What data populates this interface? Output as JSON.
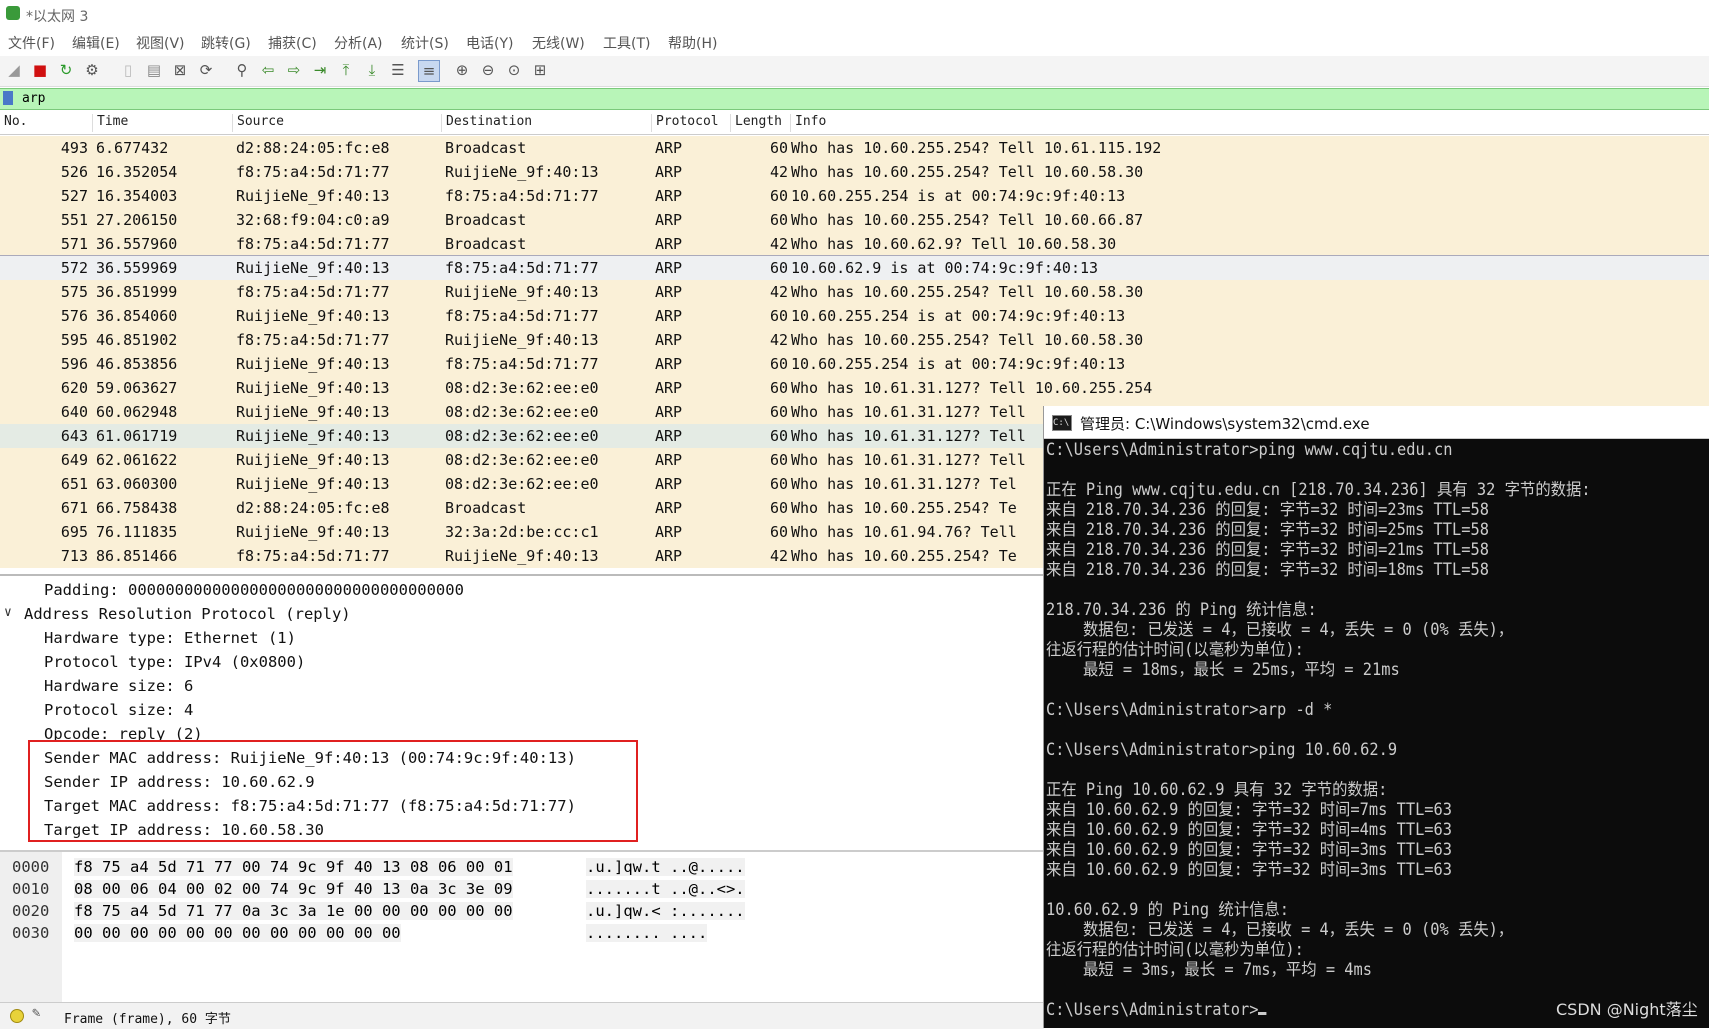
{
  "window": {
    "title": "*以太网 3"
  },
  "menu": [
    "文件(F)",
    "编辑(E)",
    "视图(V)",
    "跳转(G)",
    "捕获(C)",
    "分析(A)",
    "统计(S)",
    "电话(Y)",
    "无线(W)",
    "工具(T)",
    "帮助(H)"
  ],
  "toolbar_icons": [
    "shark-fin-start-icon",
    "stop-capture-icon",
    "restart-capture-icon",
    "capture-options-icon",
    "open-file-icon",
    "save-file-icon",
    "close-file-icon",
    "reload-icon",
    "find-packet-icon",
    "go-back-icon",
    "go-forward-icon",
    "go-to-packet-icon",
    "go-first-icon",
    "go-last-icon",
    "auto-scroll-icon",
    "colorize-icon",
    "zoom-in-icon",
    "zoom-out-icon",
    "zoom-normal-icon",
    "resize-columns-icon"
  ],
  "filter": {
    "value": "arp"
  },
  "packet_list": {
    "headers": [
      "No.",
      "Time",
      "Source",
      "Destination",
      "Protocol",
      "Length",
      "Info"
    ],
    "rows": [
      {
        "no": "493",
        "time": "6.677432",
        "src": "d2:88:24:05:fc:e8",
        "dst": "Broadcast",
        "proto": "ARP",
        "len": "60",
        "info": "Who has 10.60.255.254? Tell 10.61.115.192"
      },
      {
        "no": "526",
        "time": "16.352054",
        "src": "f8:75:a4:5d:71:77",
        "dst": "RuijieNe_9f:40:13",
        "proto": "ARP",
        "len": "42",
        "info": "Who has 10.60.255.254? Tell 10.60.58.30"
      },
      {
        "no": "527",
        "time": "16.354003",
        "src": "RuijieNe_9f:40:13",
        "dst": "f8:75:a4:5d:71:77",
        "proto": "ARP",
        "len": "60",
        "info": "10.60.255.254 is at 00:74:9c:9f:40:13"
      },
      {
        "no": "551",
        "time": "27.206150",
        "src": "32:68:f9:04:c0:a9",
        "dst": "Broadcast",
        "proto": "ARP",
        "len": "60",
        "info": "Who has 10.60.255.254? Tell 10.60.66.87"
      },
      {
        "no": "571",
        "time": "36.557960",
        "src": "f8:75:a4:5d:71:77",
        "dst": "Broadcast",
        "proto": "ARP",
        "len": "42",
        "info": "Who has 10.60.62.9? Tell 10.60.58.30"
      },
      {
        "no": "572",
        "time": "36.559969",
        "src": "RuijieNe_9f:40:13",
        "dst": "f8:75:a4:5d:71:77",
        "proto": "ARP",
        "len": "60",
        "info": "10.60.62.9 is at 00:74:9c:9f:40:13"
      },
      {
        "no": "575",
        "time": "36.851999",
        "src": "f8:75:a4:5d:71:77",
        "dst": "RuijieNe_9f:40:13",
        "proto": "ARP",
        "len": "42",
        "info": "Who has 10.60.255.254? Tell 10.60.58.30"
      },
      {
        "no": "576",
        "time": "36.854060",
        "src": "RuijieNe_9f:40:13",
        "dst": "f8:75:a4:5d:71:77",
        "proto": "ARP",
        "len": "60",
        "info": "10.60.255.254 is at 00:74:9c:9f:40:13"
      },
      {
        "no": "595",
        "time": "46.851902",
        "src": "f8:75:a4:5d:71:77",
        "dst": "RuijieNe_9f:40:13",
        "proto": "ARP",
        "len": "42",
        "info": "Who has 10.60.255.254? Tell 10.60.58.30"
      },
      {
        "no": "596",
        "time": "46.853856",
        "src": "RuijieNe_9f:40:13",
        "dst": "f8:75:a4:5d:71:77",
        "proto": "ARP",
        "len": "60",
        "info": "10.60.255.254 is at 00:74:9c:9f:40:13"
      },
      {
        "no": "620",
        "time": "59.063627",
        "src": "RuijieNe_9f:40:13",
        "dst": "08:d2:3e:62:ee:e0",
        "proto": "ARP",
        "len": "60",
        "info": "Who has 10.61.31.127? Tell 10.60.255.254"
      },
      {
        "no": "640",
        "time": "60.062948",
        "src": "RuijieNe_9f:40:13",
        "dst": "08:d2:3e:62:ee:e0",
        "proto": "ARP",
        "len": "60",
        "info": "Who has 10.61.31.127? Tell"
      },
      {
        "no": "643",
        "time": "61.061719",
        "src": "RuijieNe_9f:40:13",
        "dst": "08:d2:3e:62:ee:e0",
        "proto": "ARP",
        "len": "60",
        "info": "Who has 10.61.31.127? Tell"
      },
      {
        "no": "649",
        "time": "62.061622",
        "src": "RuijieNe_9f:40:13",
        "dst": "08:d2:3e:62:ee:e0",
        "proto": "ARP",
        "len": "60",
        "info": "Who has 10.61.31.127? Tell"
      },
      {
        "no": "651",
        "time": "63.060300",
        "src": "RuijieNe_9f:40:13",
        "dst": "08:d2:3e:62:ee:e0",
        "proto": "ARP",
        "len": "60",
        "info": "Who has 10.61.31.127? Tel"
      },
      {
        "no": "671",
        "time": "66.758438",
        "src": "d2:88:24:05:fc:e8",
        "dst": "Broadcast",
        "proto": "ARP",
        "len": "60",
        "info": "Who has 10.60.255.254? Te"
      },
      {
        "no": "695",
        "time": "76.111835",
        "src": "RuijieNe_9f:40:13",
        "dst": "32:3a:2d:be:cc:c1",
        "proto": "ARP",
        "len": "60",
        "info": "Who has 10.61.94.76? Tell"
      },
      {
        "no": "713",
        "time": "86.851466",
        "src": "f8:75:a4:5d:71:77",
        "dst": "RuijieNe_9f:40:13",
        "proto": "ARP",
        "len": "42",
        "info": "Who has 10.60.255.254? Te"
      }
    ]
  },
  "details": {
    "padding": "Padding: 000000000000000000000000000000000000",
    "arp_header": "Address Resolution Protocol (reply)",
    "fields": [
      "Hardware type: Ethernet (1)",
      "Protocol type: IPv4 (0x0800)",
      "Hardware size: 6",
      "Protocol size: 4",
      "Opcode: reply (2)",
      "Sender MAC address: RuijieNe_9f:40:13 (00:74:9c:9f:40:13)",
      "Sender IP address: 10.60.62.9",
      "Target MAC address: f8:75:a4:5d:71:77 (f8:75:a4:5d:71:77)",
      "Target IP address: 10.60.58.30"
    ]
  },
  "hex": [
    {
      "offset": "0000",
      "bytes": "f8 75 a4 5d 71 77 00 74  9c 9f 40 13 08 06 00 01",
      "ascii": ".u.]qw.t ..@....."
    },
    {
      "offset": "0010",
      "bytes": "08 00 06 04 00 02 00 74  9c 9f 40 13 0a 3c 3e 09",
      "ascii": ".......t ..@..<>."
    },
    {
      "offset": "0020",
      "bytes": "f8 75 a4 5d 71 77 0a 3c  3a 1e 00 00 00 00 00 00",
      "ascii": ".u.]qw.< :......."
    },
    {
      "offset": "0030",
      "bytes": "00 00 00 00 00 00 00 00  00 00 00 00",
      "ascii": "........ ...."
    }
  ],
  "status": {
    "text": "Frame (frame), 60 字节"
  },
  "cmd": {
    "title": "管理员: C:\\Windows\\system32\\cmd.exe",
    "lines": [
      "C:\\Users\\Administrator>ping www.cqjtu.edu.cn",
      "",
      "正在 Ping www.cqjtu.edu.cn [218.70.34.236] 具有 32 字节的数据:",
      "来自 218.70.34.236 的回复: 字节=32 时间=23ms TTL=58",
      "来自 218.70.34.236 的回复: 字节=32 时间=25ms TTL=58",
      "来自 218.70.34.236 的回复: 字节=32 时间=21ms TTL=58",
      "来自 218.70.34.236 的回复: 字节=32 时间=18ms TTL=58",
      "",
      "218.70.34.236 的 Ping 统计信息:",
      "    数据包: 已发送 = 4，已接收 = 4，丢失 = 0 (0% 丢失)，",
      "往返行程的估计时间(以毫秒为单位):",
      "    最短 = 18ms，最长 = 25ms，平均 = 21ms",
      "",
      "C:\\Users\\Administrator>arp -d *",
      "",
      "C:\\Users\\Administrator>ping 10.60.62.9",
      "",
      "正在 Ping 10.60.62.9 具有 32 字节的数据:",
      "来自 10.60.62.9 的回复: 字节=32 时间=7ms TTL=63",
      "来自 10.60.62.9 的回复: 字节=32 时间=4ms TTL=63",
      "来自 10.60.62.9 的回复: 字节=32 时间=3ms TTL=63",
      "来自 10.60.62.9 的回复: 字节=32 时间=3ms TTL=63",
      "",
      "10.60.62.9 的 Ping 统计信息:",
      "    数据包: 已发送 = 4，已接收 = 4，丢失 = 0 (0% 丢失)，",
      "往返行程的估计时间(以毫秒为单位):",
      "    最短 = 3ms，最长 = 7ms，平均 = 4ms",
      "",
      "C:\\Users\\Administrator>"
    ]
  },
  "watermark": "CSDN @Night落尘"
}
